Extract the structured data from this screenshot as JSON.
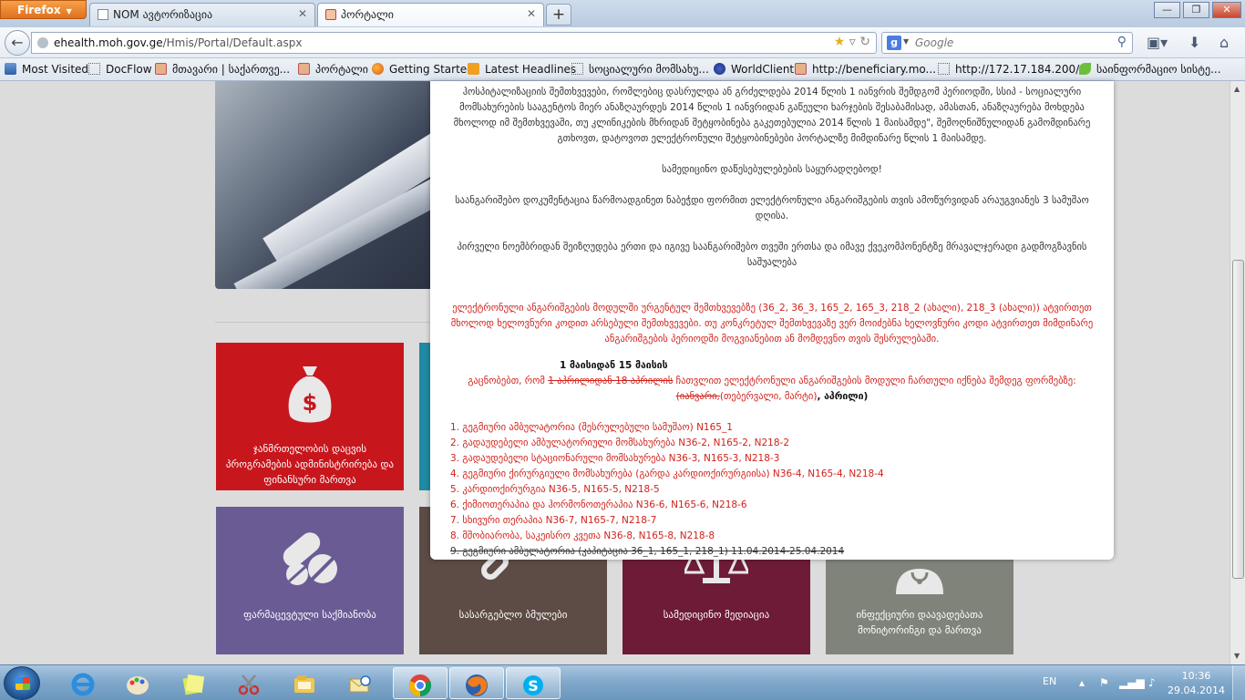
{
  "browser": {
    "app_button": "Firefox",
    "tabs": [
      {
        "label": "NOM ავტორიზაცია",
        "active": false
      },
      {
        "label": "პორტალი",
        "active": true
      }
    ],
    "new_tab": "+",
    "window_controls": {
      "minimize": "—",
      "maximize": "❐",
      "close": "✕"
    }
  },
  "navbar": {
    "url_host": "ehealth.moh.gov.ge",
    "url_path": "/Hmis/Portal/Default.aspx",
    "search_placeholder": "Google",
    "search_engine_letter": "g"
  },
  "bookmarks": [
    {
      "label": "Most Visited",
      "icon": "most-visited-icon"
    },
    {
      "label": "DocFlow",
      "icon": "folder-icon"
    },
    {
      "label": "მთავარი | საქართვე...",
      "icon": "gov-seal-icon"
    },
    {
      "label": "პორტალი",
      "icon": "gov-seal-icon"
    },
    {
      "label": "Getting Started",
      "icon": "firefox-icon"
    },
    {
      "label": "Latest Headlines",
      "icon": "rss-icon"
    },
    {
      "label": "სოციალური მომსახუ...",
      "icon": "folder-icon"
    },
    {
      "label": "WorldClient",
      "icon": "globe-icon"
    },
    {
      "label": "http://beneficiary.mo...",
      "icon": "gov-seal-icon"
    },
    {
      "label": "http://172.17.184.200/...",
      "icon": "folder-icon"
    },
    {
      "label": "საინფორმაციო სისტე...",
      "icon": "leaf-icon"
    }
  ],
  "tiles": [
    {
      "label": "ჯანმრთელობის დაცვის პროგრამების ადმინისტრირება და ფინანსური მართვა",
      "color": "#c8161d",
      "icon": "money-bag-icon"
    },
    {
      "label": "ფარმაცევტული საქმიანობა",
      "color": "#6b5b95",
      "icon": "pills-icon"
    },
    {
      "label": "სასარგებლო ბმულები",
      "color": "#5d4b45",
      "icon": "link-icon"
    },
    {
      "label": "სამედიცინო მედიაცია",
      "color": "#6e1b38",
      "icon": "scales-icon"
    },
    {
      "label": "ინფექციური დაავადებათა მონიტორინგი და მართვა",
      "color": "#7f837a",
      "icon": "doctor-icon"
    }
  ],
  "modal": {
    "para1": "ჰოსპიტალიზაციის შემთხვევები, რომლებიც დასრულდა ან გრძელდება 2014 წლის 1 იანვრის შემდგომ პერიოდში, სსიპ - სოციალური მომსახურების სააგენტოს მიერ ანაზღაურდეს 2014 წლის 1 იანვრიდან გაწეული ხარჯების შესაბამისად, ამასთან, ანაზღაურება მოხდება მხოლოდ იმ შემთხვევაში, თუ კლინიკების მხრიდან შეტყობინება გაკეთებულია 2014 წლის 1 მაისამდე\", შემოღნიშნულიდან გამომდინარე გთხოვთ, დატოვოთ ელექტრონული შეტყობინებები პორტალზე მიმდინარე წლის 1 მაისამდე.",
    "para2": "სამედიცინო დაწესებულებების საყურადღებოდ!",
    "para3": "საანგარიშებო დოკუმენტაცია წარმოადგინეთ ნაბეჭდი ფორმით ელექტრონული ანგარიშგების თვის ამოწურვიდან არაუგვიანეს 3 სამუშაო დღისა.",
    "para4": "პირველი ნოემბრიდან შეიზღუდება ერთი და იგივე საანგარიშებო თვეში ერთსა და იმავე ქვეკომპონენტზე მრავალჯერადი გადმოგზავნის საშუალება",
    "red_para": "ელექტრონული ანგარიშგების მოდულში ურგენტულ შემთხვევებზე (36_2, 36_3, 165_2, 165_3, 218_2 (ახალი), 218_3 (ახალი)) ატვირთეთ მხოლოდ ხელოვნური კოდით არსებული შემთხვევები. თუ კონკრეტულ შემთხვევაზე ვერ მოიძებნა ხელოვნური კოდი ატვირთეთ მიმდინარე ანგარიშგების პერიოდში მოგვიანებით ან მომდევნო თვის შესრულებაში.",
    "date_range": "1 მაისიდან 15 მაისის",
    "notice_pre": "გაცნობებთ, რომ ",
    "notice_struck": "1 აპრილიდან 18 აპრილის",
    "notice_mid": " ჩათვლით ელექტრონული ანგარიშგების მოდული ჩართული იქნება შემდეგ ფორმებზე: ",
    "notice_struck2": "(იანვარი,",
    "notice_after": "(თებერვალი, მარტი)",
    "notice_bold_end": ", აპრილი)",
    "list": [
      {
        "text": "1. გეგმიური ამბულატორია (შესრულებული სამუშაო) N165_1",
        "struck": false
      },
      {
        "text": "2. გადაუდებელი ამბულატორიული მომსახურება N36-2, N165-2, N218-2",
        "struck": false
      },
      {
        "text": "3. გადაუდებელი სტაციონარული მომსახურება N36-3, N165-3, N218-3",
        "struck": false
      },
      {
        "text": "4. გეგმიური ქირურგიული მომსახურება (გარდა კარდიოქირურგიისა) N36-4, N165-4, N218-4",
        "struck": false
      },
      {
        "text": "5. კარდიოქირურგია N36-5, N165-5, N218-5",
        "struck": false
      },
      {
        "text": "6. ქიმიოთერაპია და ჰორმონოთერაპია N36-6, N165-6, N218-6",
        "struck": false
      },
      {
        "text": "7. სხივური თერაპია N36-7, N165-7, N218-7",
        "struck": false
      },
      {
        "text": "8. მშობიარობა, საკეისრო კვეთა N36-8, N165-8, N218-8",
        "struck": false
      },
      {
        "text": "9. გეგმიური ამბულატორია (კაპიტაცია 36_1, 165_1, 218_1) 11.04.2014-25.04.2014",
        "struck": true
      }
    ]
  },
  "taskbar": {
    "language": "EN",
    "time": "10:36",
    "date": "29.04.2014"
  }
}
